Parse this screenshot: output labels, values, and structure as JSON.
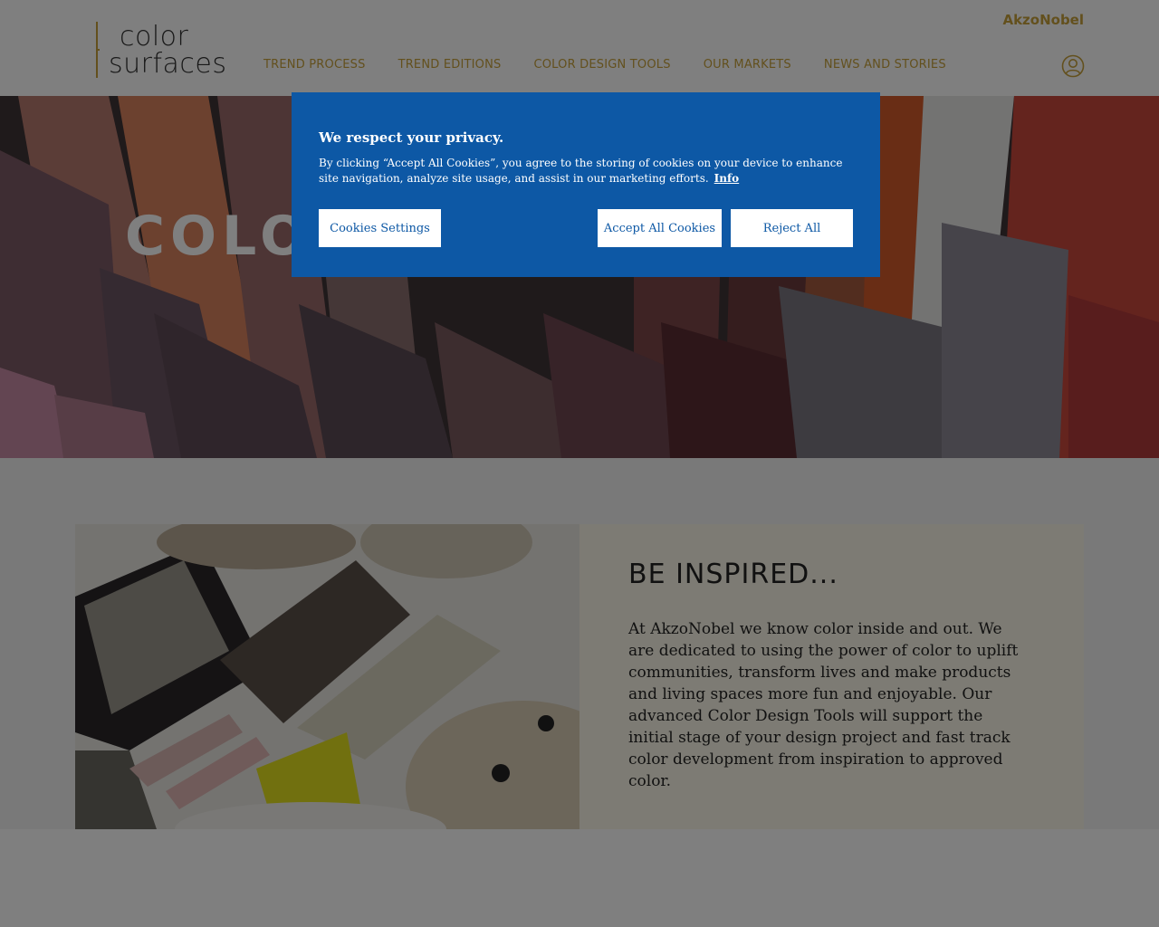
{
  "header": {
    "logo_line1": "color",
    "logo_line2": "surfaces",
    "brand": "AkzoNobel",
    "nav": [
      "TREND PROCESS",
      "TREND EDITIONS",
      "COLOR DESIGN TOOLS",
      "OUR MARKETS",
      "NEWS AND STORIES"
    ],
    "user_icon": "user-icon"
  },
  "hero": {
    "title_visible": "COLO"
  },
  "section": {
    "title": "BE INSPIRED...",
    "body": "At AkzoNobel we know color inside and out. We are dedicated to using the power of color to uplift communities, transform lives and make products and living spaces more fun and enjoyable. Our advanced Color Design Tools will support the initial stage of your design project and fast track color development from inspiration to approved color."
  },
  "cookie": {
    "title": "We respect your privacy.",
    "text": "By clicking “Accept All Cookies”, you agree to the storing of cookies on your device to enhance site navigation, analyze site usage, and assist in our marketing efforts.",
    "info_link": "Info",
    "settings_label": "Cookies Settings",
    "accept_label": "Accept All Cookies",
    "reject_label": "Reject All"
  },
  "colors": {
    "gold": "#c6a13b",
    "cookie_blue": "#0d58a5",
    "card_bg": "#fbf7e8"
  }
}
